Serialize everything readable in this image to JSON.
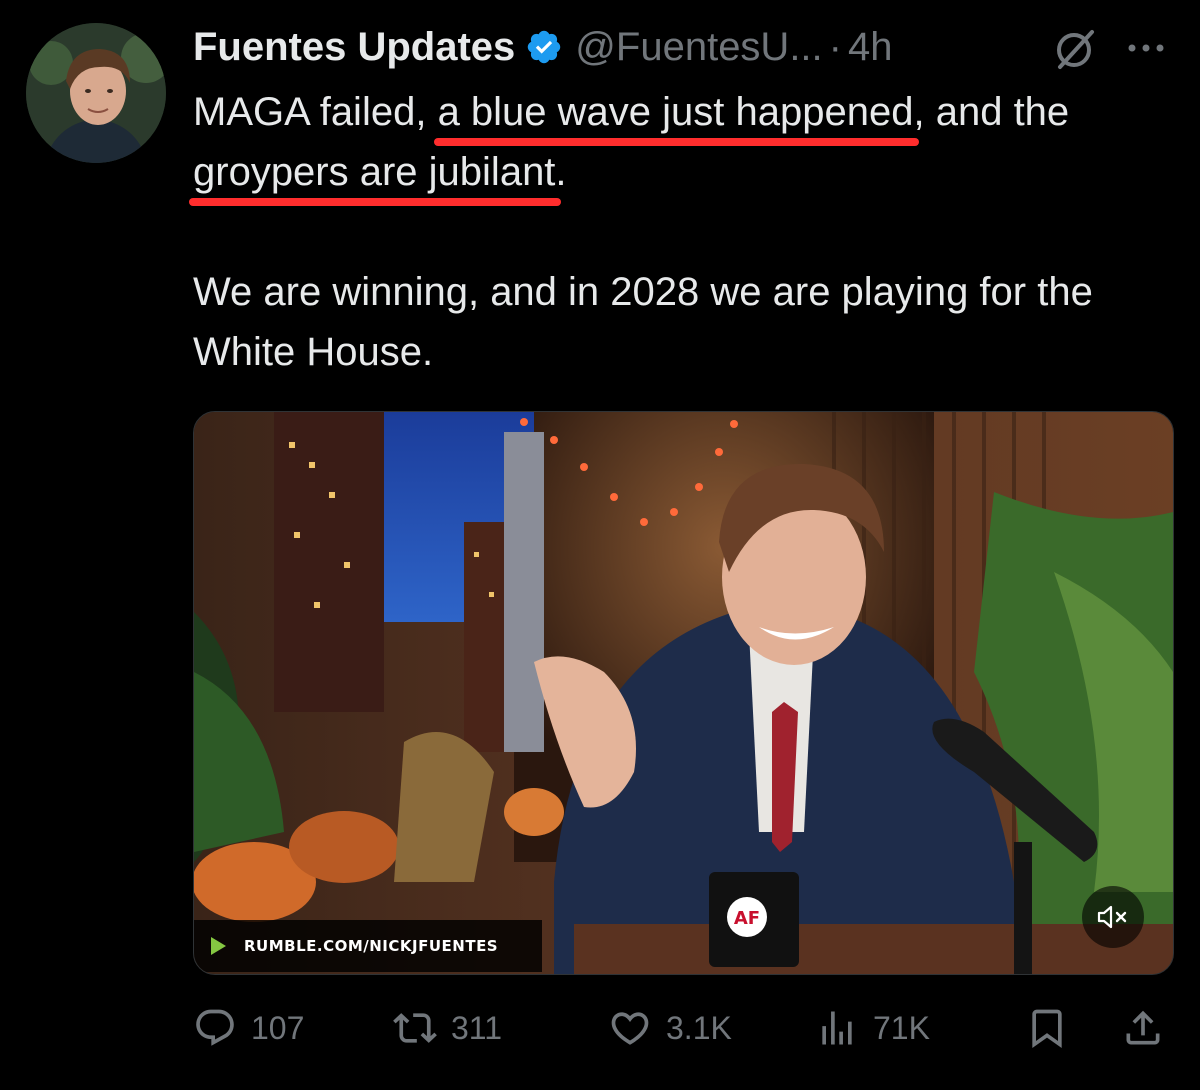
{
  "author": {
    "display_name": "Fuentes Updates",
    "handle": "@FuentesU...",
    "separator": "·",
    "time": "4h",
    "verified_icon": "verified-badge-icon"
  },
  "tweet": {
    "p1_before": "MAGA failed, ",
    "p1_hl1": "a blue wave just happened",
    "p1_mid": ", and the ",
    "p1_hl2": "groypers are jubilant",
    "p1_after": ".",
    "p2": "We are winning, and in 2028 we are playing for the White House."
  },
  "media": {
    "watermark": "RUMBLE.COM/NICKJFUENTES",
    "mug_logo": "AF",
    "mute_icon": "mute-icon"
  },
  "actions": {
    "replies": "107",
    "reposts": "311",
    "likes": "3.1K",
    "views": "71K"
  },
  "colors": {
    "background": "#000000",
    "text": "#e7e9ea",
    "muted": "#71767b",
    "verified": "#1d9bf0",
    "highlight_underline": "#ff2d2d"
  }
}
